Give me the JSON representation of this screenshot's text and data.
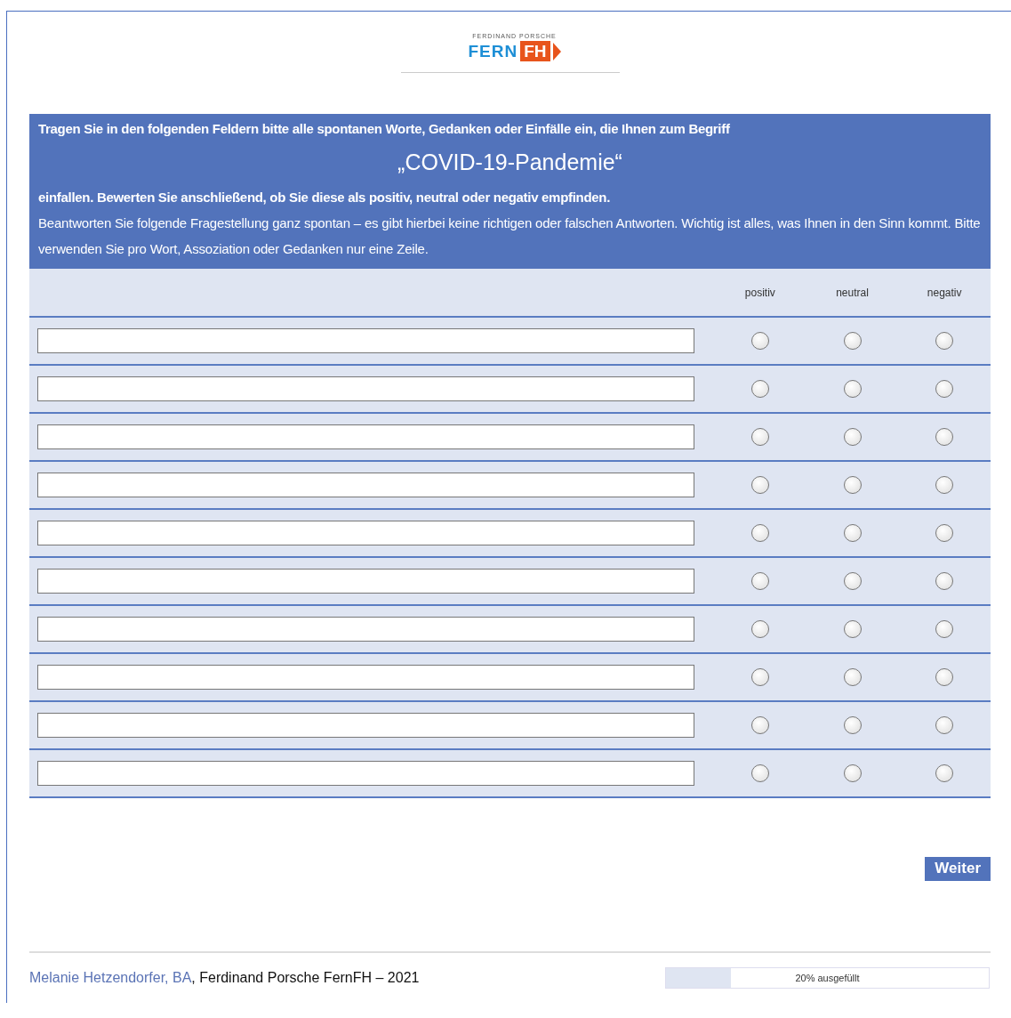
{
  "logo": {
    "top": "FERDINAND PORSCHE",
    "main": "FERN",
    "badge": "FH"
  },
  "instructions": {
    "lead": "Tragen Sie in den folgenden Feldern bitte alle spontanen Worte, Gedanken oder Einfälle ein, die Ihnen zum Begriff",
    "term": "„COVID-19-Pandemie“",
    "follow": "einfallen. Bewerten Sie anschließend, ob Sie diese als positiv, neutral oder negativ empfinden.",
    "note": "Beantworten Sie folgende Fragestellung ganz spontan – es gibt hierbei keine richtigen oder falschen Antworten. Wichtig ist alles, was Ihnen in den Sinn kommt. Bitte verwenden Sie pro Wort, Assoziation oder Gedanken nur eine Zeile."
  },
  "columns": [
    "positiv",
    "neutral",
    "negativ"
  ],
  "rows": [
    {
      "options": [
        {
          "selected": false
        },
        {
          "selected": false
        },
        {
          "selected": false
        }
      ]
    },
    {
      "options": [
        {
          "selected": false
        },
        {
          "selected": false
        },
        {
          "selected": false
        }
      ]
    },
    {
      "options": [
        {
          "selected": false
        },
        {
          "selected": false
        },
        {
          "selected": false
        }
      ]
    },
    {
      "options": [
        {
          "selected": false
        },
        {
          "selected": false
        },
        {
          "selected": false
        }
      ]
    },
    {
      "options": [
        {
          "selected": false
        },
        {
          "selected": false
        },
        {
          "selected": false
        }
      ]
    },
    {
      "options": [
        {
          "selected": false
        },
        {
          "selected": false
        },
        {
          "selected": false
        }
      ]
    },
    {
      "options": [
        {
          "selected": false
        },
        {
          "selected": false
        },
        {
          "selected": false
        }
      ]
    },
    {
      "options": [
        {
          "selected": false
        },
        {
          "selected": false
        },
        {
          "selected": false
        }
      ]
    },
    {
      "options": [
        {
          "selected": false
        },
        {
          "selected": false
        },
        {
          "selected": false
        }
      ]
    },
    {
      "options": [
        {
          "selected": false
        },
        {
          "selected": false
        },
        {
          "selected": false
        }
      ]
    }
  ],
  "next_button": "Weiter",
  "footer": {
    "author": "Melanie Hetzendorfer, BA",
    "credit": ", Ferdinand Porsche FernFH – 2021"
  },
  "progress": {
    "level": 0.2,
    "label": "20% ausgefüllt"
  }
}
